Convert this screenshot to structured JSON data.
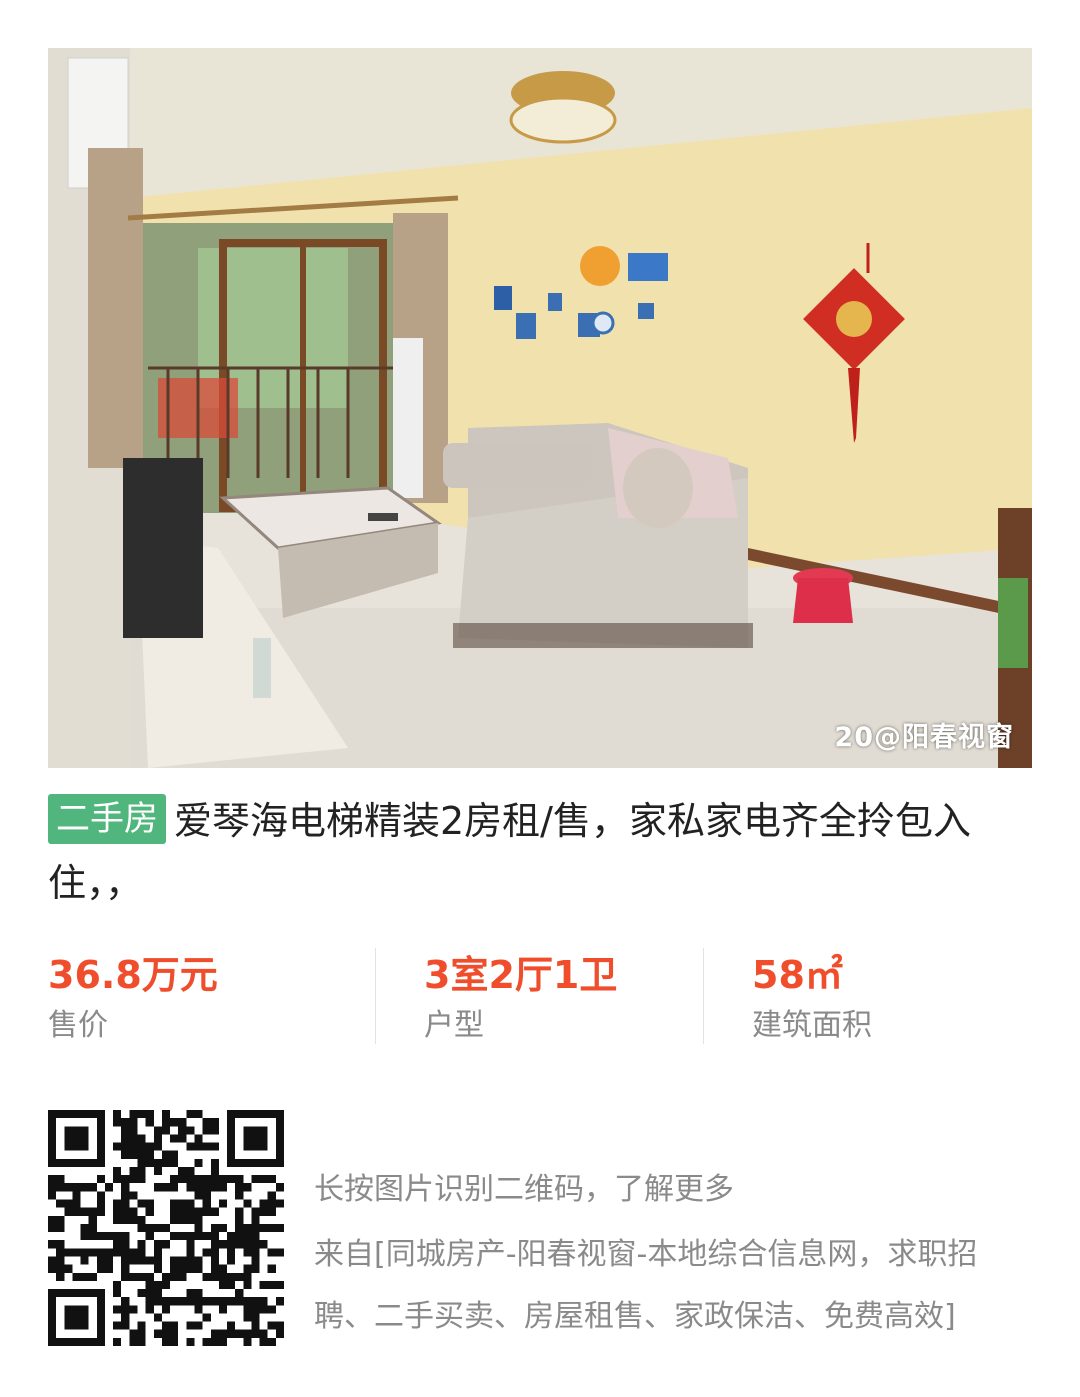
{
  "photo": {
    "description_icon": "living-room-photo",
    "watermark": "20@阳春视窗"
  },
  "listing": {
    "tag": "二手房",
    "title": "爱琴海电梯精装2房租/售，家私家电齐全拎包入住，，"
  },
  "stats": [
    {
      "value": "36.8万元",
      "label": "售价"
    },
    {
      "value": "3室2厅1卫",
      "label": "户型"
    },
    {
      "value": "58㎡",
      "label": "建筑面积"
    }
  ],
  "qr": {
    "icon": "qr-code-icon"
  },
  "info": {
    "hint": "长按图片识别二维码，了解更多",
    "source": "来自[同城房产-阳春视窗-本地综合信息网，求职招聘、二手买卖、房屋租售、家政保洁、免费高效]"
  },
  "colors": {
    "price": "#ef4d2c",
    "tag_bg": "#51b67e",
    "label": "#8a8a8a"
  }
}
